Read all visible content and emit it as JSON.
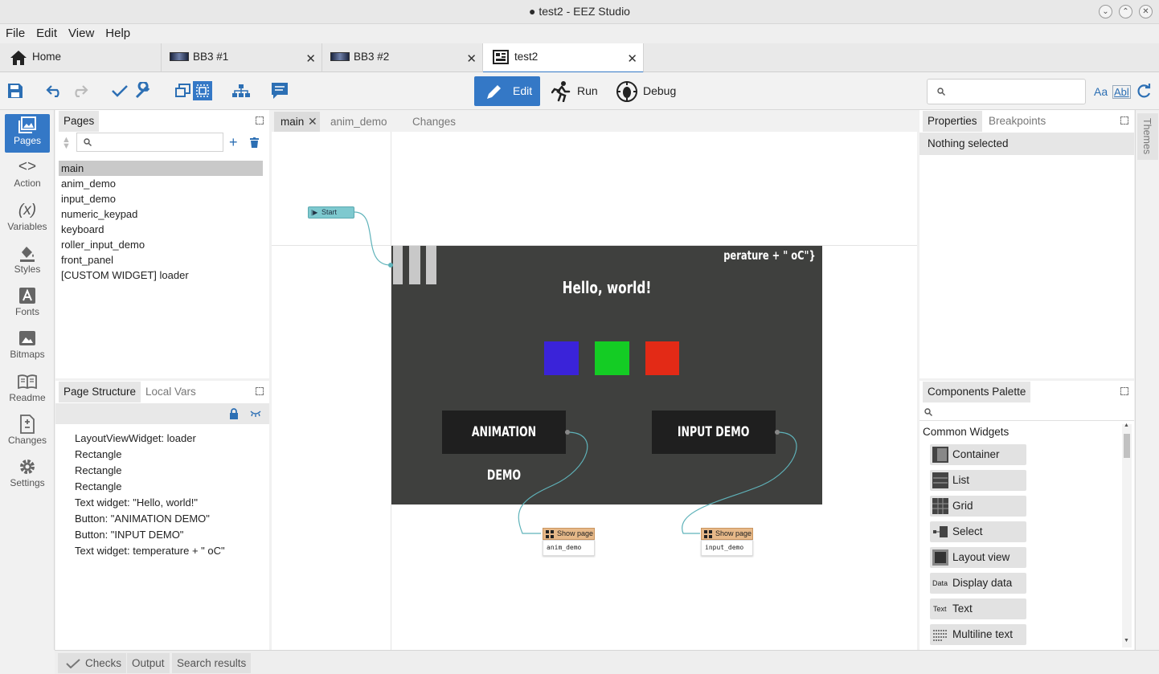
{
  "window": {
    "title": "● test2 - EEZ Studio"
  },
  "menu": [
    "File",
    "Edit",
    "View",
    "Help"
  ],
  "tabs": [
    {
      "label": "Home"
    },
    {
      "label": "BB3 #1"
    },
    {
      "label": "BB3 #2"
    },
    {
      "label": "test2"
    }
  ],
  "modes": {
    "edit": "Edit",
    "run": "Run",
    "debug": "Debug"
  },
  "search": {
    "aa": "Aa",
    "abl": "Abl"
  },
  "leftnav": [
    "Pages",
    "Action",
    "Variables",
    "Styles",
    "Fonts",
    "Bitmaps",
    "Readme",
    "Changes",
    "Settings"
  ],
  "pages_panel": {
    "title": "Pages",
    "items": [
      "main",
      "anim_demo",
      "input_demo",
      "numeric_keypad",
      "keyboard",
      "roller_input_demo",
      "front_panel",
      "[CUSTOM WIDGET] loader"
    ],
    "selected": "main"
  },
  "structure_panel": {
    "tab1": "Page Structure",
    "tab2": "Local Vars",
    "items": [
      "LayoutViewWidget: loader",
      "Rectangle",
      "Rectangle",
      "Rectangle",
      "Text widget: \"Hello, world!\"",
      "Button: \"ANIMATION DEMO\"",
      "Button: \"INPUT DEMO\"",
      "Text widget: temperature + \" oC\""
    ]
  },
  "editor_tabs": [
    "main",
    "anim_demo",
    "Changes"
  ],
  "canvas": {
    "start_label": "Start",
    "temp_text": "perature + \" oC\"}",
    "hello": "Hello, world!",
    "anim_btn": "ANIMATION DEMO",
    "input_btn": "INPUT DEMO",
    "show_page": "Show page",
    "show_page_target1": "anim_demo",
    "show_page_target2": "input_demo",
    "colors": {
      "blue": "#3a23d9",
      "green": "#14cc24",
      "red": "#e32a16",
      "screen": "#3f403e"
    }
  },
  "properties_panel": {
    "tab1": "Properties",
    "tab2": "Breakpoints",
    "empty": "Nothing selected"
  },
  "themes_label": "Themes",
  "palette": {
    "title": "Components Palette",
    "group": "Common Widgets",
    "items": [
      "Container",
      "List",
      "Grid",
      "Select",
      "Layout view",
      "Display data",
      "Text",
      "Multiline text"
    ],
    "icon_text": {
      "data": "Data",
      "text": "Text"
    }
  },
  "bottom": {
    "checks": "Checks",
    "output": "Output",
    "search_results": "Search results"
  }
}
